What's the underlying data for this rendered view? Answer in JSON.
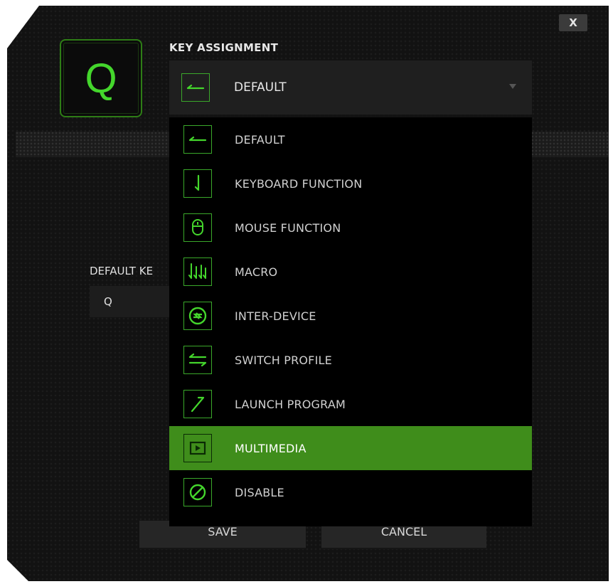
{
  "window": {
    "close_label": "X"
  },
  "key": {
    "label": "Q"
  },
  "key_assignment": {
    "title": "KEY ASSIGNMENT",
    "selected": {
      "label": "DEFAULT",
      "icon": "default-arrow-icon"
    },
    "options": [
      {
        "label": "DEFAULT",
        "icon": "default-arrow-icon"
      },
      {
        "label": "KEYBOARD FUNCTION",
        "icon": "keyboard-function-icon"
      },
      {
        "label": "MOUSE FUNCTION",
        "icon": "mouse-icon"
      },
      {
        "label": "MACRO",
        "icon": "macro-icon"
      },
      {
        "label": "INTER-DEVICE",
        "icon": "inter-device-icon"
      },
      {
        "label": "SWITCH PROFILE",
        "icon": "switch-profile-icon"
      },
      {
        "label": "LAUNCH PROGRAM",
        "icon": "launch-program-icon"
      },
      {
        "label": "MULTIMEDIA",
        "icon": "multimedia-icon"
      },
      {
        "label": "DISABLE",
        "icon": "disable-icon"
      }
    ],
    "highlighted": "MULTIMEDIA"
  },
  "default_key": {
    "label": "DEFAULT KE",
    "value": "Q"
  },
  "buttons": {
    "save": "SAVE",
    "cancel": "CANCEL"
  },
  "colors": {
    "accent": "#44d62c",
    "highlight": "#3f8d1b",
    "background": "#121212"
  }
}
